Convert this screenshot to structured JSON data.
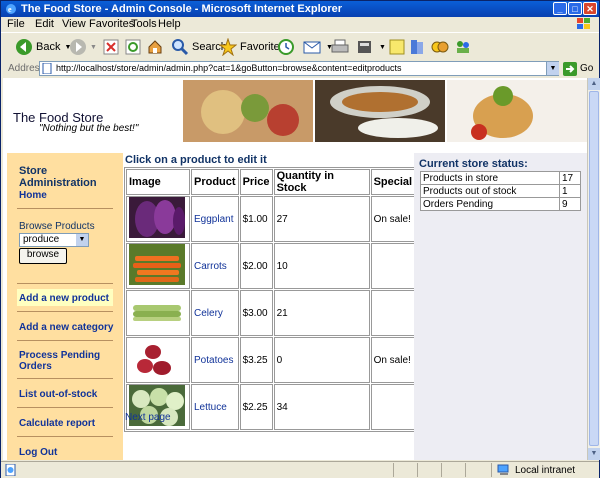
{
  "window": {
    "title": "The Food Store - Admin Console - Microsoft Internet Explorer"
  },
  "menu": {
    "items": [
      "File",
      "Edit",
      "View",
      "Favorites",
      "Tools",
      "Help"
    ]
  },
  "toolbar": {
    "back_label": "Back",
    "search_label": "Search",
    "favorites_label": "Favorites"
  },
  "address": {
    "label": "Address",
    "url": "http://localhost/store/admin/admin.php?cat=1&goButton=browse&content=editproducts",
    "go_label": "Go"
  },
  "header": {
    "store_name": "The Food Store",
    "tagline": "\"Nothing but the best!\""
  },
  "sidebar": {
    "heading": "Store Administration",
    "home": "Home",
    "browse_label": "Browse Products",
    "browse_select": "produce",
    "browse_button": "browse",
    "links": {
      "add_product": "Add a new product",
      "add_category": "Add a new category",
      "process_orders": "Process Pending Orders",
      "list_oos": "List out-of-stock",
      "calc_report": "Calculate report",
      "logout": "Log Out"
    }
  },
  "products": {
    "heading": "Click on a product to edit it",
    "columns": [
      "Image",
      "Product",
      "Price",
      "Quantity in Stock",
      "Special"
    ],
    "rows": [
      {
        "name": "Eggplant",
        "price": "$1.00",
        "qty": "27",
        "special": "On sale!"
      },
      {
        "name": "Carrots",
        "price": "$2.00",
        "qty": "10",
        "special": ""
      },
      {
        "name": "Celery",
        "price": "$3.00",
        "qty": "21",
        "special": ""
      },
      {
        "name": "Potatoes",
        "price": "$3.25",
        "qty": "0",
        "special": "On sale!"
      },
      {
        "name": "Lettuce",
        "price": "$2.25",
        "qty": "34",
        "special": ""
      }
    ],
    "next_page": "Next page"
  },
  "status": {
    "heading": "Current store status:",
    "rows": [
      {
        "label": "Products in store",
        "value": "17"
      },
      {
        "label": "Products out of stock",
        "value": "1"
      },
      {
        "label": "Orders Pending",
        "value": "9"
      }
    ]
  },
  "statusbar": {
    "zone": "Local intranet"
  },
  "colors": {
    "sidebar_bg": "#ffdfa0",
    "link": "#113399",
    "heading": "#113366",
    "titlebar": "#0a5fd8"
  }
}
